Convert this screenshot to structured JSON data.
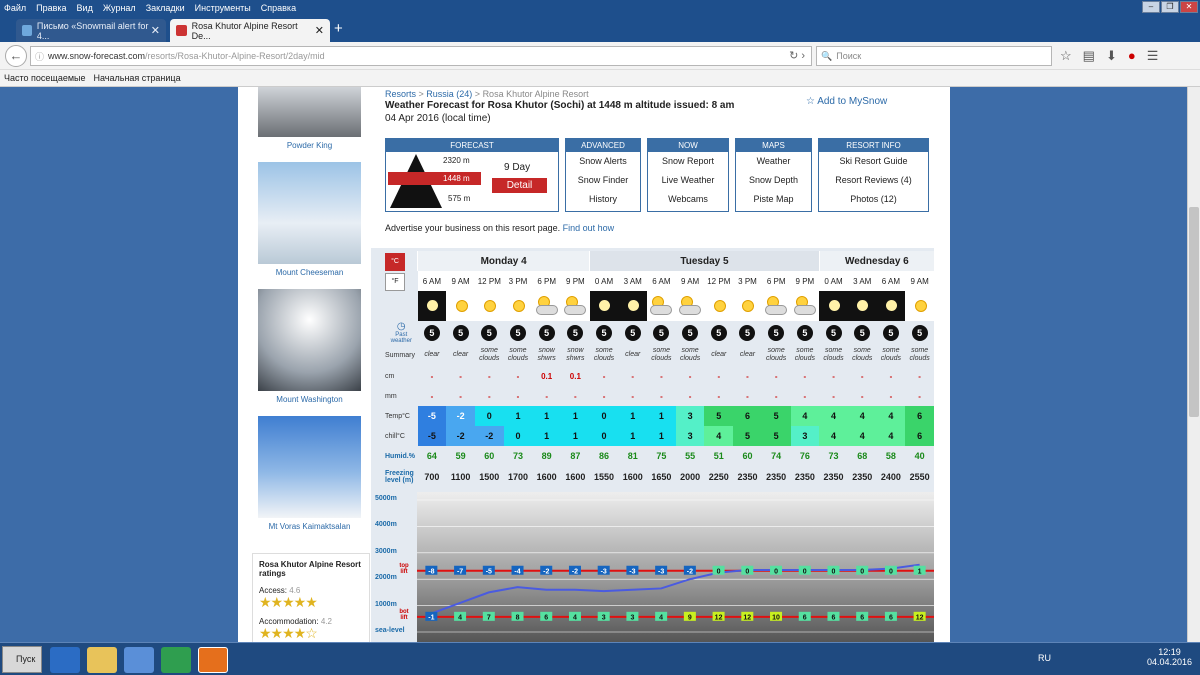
{
  "menu": {
    "items": [
      "Файл",
      "Правка",
      "Вид",
      "Журнал",
      "Закладки",
      "Инструменты",
      "Справка"
    ]
  },
  "tabs": [
    {
      "label": "Письмо «Snowmail alert for 4..."
    },
    {
      "label": "Rosa Khutor Alpine Resort De..."
    }
  ],
  "url": {
    "domain": "www.snow-forecast.com",
    "path": "/resorts/Rosa-Khutor-Alpine-Resort/2day/mid"
  },
  "search": {
    "placeholder": "Поиск"
  },
  "bookmarks": [
    "Часто посещаемые",
    "Начальная страница"
  ],
  "sidebar": {
    "captions": [
      "Powder King",
      "Mount Cheeseman",
      "Mount Washington",
      "Mt Voras Kaimaktsalan"
    ],
    "ratings": {
      "title": "Rosa Khutor Alpine Resort ratings",
      "access_label": "Access:",
      "access": "4.6",
      "accom_label": "Accommodation:",
      "accom": "4.2"
    }
  },
  "main": {
    "crumbs": [
      "Resorts",
      "Russia (24)",
      "Rosa Khutor Alpine Resort"
    ],
    "title": "Weather Forecast for Rosa Khutor (Sochi) at 1448 m altitude issued:",
    "title_time": "8 am",
    "title_date": "04 Apr 2016 (local time)",
    "add_my": "Add to MySnow",
    "forecast_head": "FORECAST",
    "elev_top": "2320 m",
    "elev_mid": "1448 m",
    "elev_bot": "575 m",
    "nine_day": "9 Day",
    "detail": "Detail",
    "nav": [
      {
        "h": "ADVANCED",
        "items": [
          "Snow Alerts",
          "Snow Finder",
          "History"
        ]
      },
      {
        "h": "NOW",
        "items": [
          "Snow Report",
          "Live Weather",
          "Webcams"
        ]
      },
      {
        "h": "MAPS",
        "items": [
          "Weather",
          "Snow Depth",
          "Piste Map"
        ]
      },
      {
        "h": "RESORT INFO",
        "items": [
          "Ski Resort Guide",
          "Resort Reviews (4)",
          "Photos (12)"
        ]
      }
    ],
    "advertise": "Advertise your business on this resort page.",
    "find_out": "Find out how"
  },
  "table": {
    "unit_c": "°C",
    "unit_f": "°F",
    "past_label": "Past weather",
    "days": [
      {
        "name": "Monday 4",
        "span": 6
      },
      {
        "name": "Tuesday 5",
        "span": 8
      },
      {
        "name": "Wednesday 6",
        "span": 4
      }
    ],
    "times": [
      "6 AM",
      "9 AM",
      "12 PM",
      "3 PM",
      "6 PM",
      "9 PM",
      "0 AM",
      "3 AM",
      "6 AM",
      "9 AM",
      "12 PM",
      "3 PM",
      "6 PM",
      "9 PM",
      "0 AM",
      "3 AM",
      "6 AM",
      "9 AM"
    ],
    "wx": [
      "moon",
      "sun",
      "sun",
      "sun",
      "cloud",
      "cloud",
      "moon",
      "moon",
      "cloud",
      "cloud",
      "sun",
      "sun",
      "cloud",
      "cloud",
      "moon",
      "moon",
      "moon",
      "sun"
    ],
    "wind": [
      "5",
      "5",
      "5",
      "5",
      "5",
      "5",
      "5",
      "5",
      "5",
      "5",
      "5",
      "5",
      "5",
      "5",
      "5",
      "5",
      "5",
      "5"
    ],
    "summary": [
      "clear",
      "clear",
      "some clouds",
      "some clouds",
      "snow shwrs",
      "snow shwrs",
      "some clouds",
      "clear",
      "some clouds",
      "some clouds",
      "clear",
      "clear",
      "some clouds",
      "some clouds",
      "some clouds",
      "some clouds",
      "some clouds",
      "some clouds"
    ],
    "snow": [
      "-",
      "-",
      "-",
      "-",
      "0.1",
      "0.1",
      "-",
      "-",
      "-",
      "-",
      "-",
      "-",
      "-",
      "-",
      "-",
      "-",
      "-",
      "-"
    ],
    "rain": [
      "-",
      "-",
      "-",
      "-",
      "-",
      "-",
      "-",
      "-",
      "-",
      "-",
      "-",
      "-",
      "-",
      "-",
      "-",
      "-",
      "-",
      "-"
    ],
    "temp": [
      "-5",
      "-2",
      "0",
      "1",
      "1",
      "1",
      "0",
      "1",
      "1",
      "3",
      "5",
      "6",
      "5",
      "4",
      "4",
      "4",
      "4",
      "6"
    ],
    "chill": [
      "-5",
      "-2",
      "-2",
      "0",
      "1",
      "1",
      "0",
      "1",
      "1",
      "3",
      "4",
      "5",
      "5",
      "3",
      "4",
      "4",
      "4",
      "6"
    ],
    "humid": [
      "64",
      "59",
      "60",
      "73",
      "89",
      "87",
      "86",
      "81",
      "75",
      "55",
      "51",
      "60",
      "74",
      "76",
      "73",
      "68",
      "58",
      "40"
    ],
    "freeze": [
      "700",
      "1100",
      "1500",
      "1700",
      "1600",
      "1600",
      "1550",
      "1600",
      "1650",
      "2000",
      "2250",
      "2350",
      "2350",
      "2350",
      "2350",
      "2350",
      "2400",
      "2550"
    ],
    "labels": {
      "summary": "Summary",
      "snow": "cm",
      "rain": "mm",
      "temp": "Temp°C",
      "chill": "chill°C",
      "humid": "Humid.%",
      "freeze": "Freezing level (m)"
    },
    "y_labels": [
      "5000m",
      "4000m",
      "3000m",
      "2000m",
      "1000m",
      "sea-level"
    ],
    "top_lift": "top lift",
    "bot_lift": "bot lift",
    "top_vals": [
      "-8",
      "-7",
      "-5",
      "-4",
      "-2",
      "-2",
      "-3",
      "-3",
      "-3",
      "-2",
      "0",
      "0",
      "0",
      "0",
      "0",
      "0",
      "0",
      "1"
    ],
    "bot_vals": [
      "-1",
      "4",
      "7",
      "8",
      "6",
      "4",
      "3",
      "3",
      "4",
      "9",
      "12",
      "12",
      "10",
      "6",
      "6",
      "6",
      "6",
      "12"
    ]
  },
  "taskbar": {
    "start": "Пуск",
    "lang": "RU",
    "time": "12:19",
    "date": "04.04.2016"
  }
}
